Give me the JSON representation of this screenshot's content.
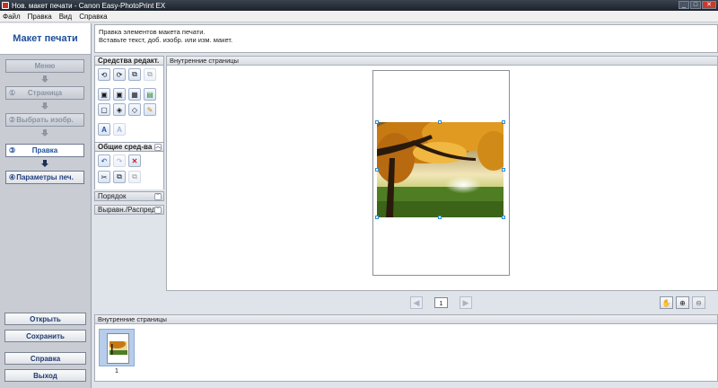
{
  "window": {
    "title": "Нов. макет печати - Canon Easy-PhotoPrint EX",
    "min_label": "_",
    "max_label": "□",
    "close_label": "✕"
  },
  "menu": [
    "Файл",
    "Правка",
    "Вид",
    "Справка"
  ],
  "left": {
    "header": "Макет печати",
    "steps": [
      {
        "num": "",
        "label": "Меню"
      },
      {
        "num": "①",
        "label": "Страница"
      },
      {
        "num": "②",
        "label": "Выбрать изобр."
      },
      {
        "num": "③",
        "label": "Правка"
      },
      {
        "num": "④",
        "label": "Параметры печ."
      }
    ],
    "buttons": [
      "Открыть",
      "Сохранить",
      "Справка",
      "Выход"
    ]
  },
  "instruction": {
    "line1": "Правка элементов макета печати.",
    "line2": "Вставьте текст, доб. изобр. или изм. макет."
  },
  "tools": {
    "edit_title": "Средства редакт.",
    "common_title": "Общие сред-ва",
    "order_title": "Порядок",
    "align_title": "Выравн./Распред.",
    "edit_icons": [
      "rotate-left-icon",
      "rotate-right-icon",
      "copy-frame-icon",
      "paste-frame-icon",
      "add-image-icon",
      "replace-image-icon",
      "crop-image-icon",
      "fit-image-icon",
      "image-frame-icon",
      "image-effect-icon",
      "shape-icon",
      "correct-image-icon",
      "text-icon",
      "text-edit-icon"
    ],
    "edit_glyphs": [
      "⟲",
      "⟳",
      "⧉",
      "⧉",
      "▣",
      "▣",
      "▦",
      "▤",
      "▢",
      "◈",
      "◇",
      "✎",
      "A",
      "A"
    ],
    "common_glyphs": [
      "↶",
      "↷",
      "✕",
      "✂",
      "⧉",
      "⧉"
    ]
  },
  "canvas": {
    "header": "Внутренние страницы",
    "page_number": "1",
    "prev_label": "◀",
    "next_label": "▶",
    "hand_glyph": "✋",
    "zoom_in_glyph": "⊕",
    "zoom_out_glyph": "⊖"
  },
  "thumbnails": {
    "header": "Внутренние страницы",
    "items": [
      {
        "label": "1"
      }
    ]
  },
  "colors": {
    "accent": "#1f4f9a",
    "delete_red": "#c62020"
  }
}
